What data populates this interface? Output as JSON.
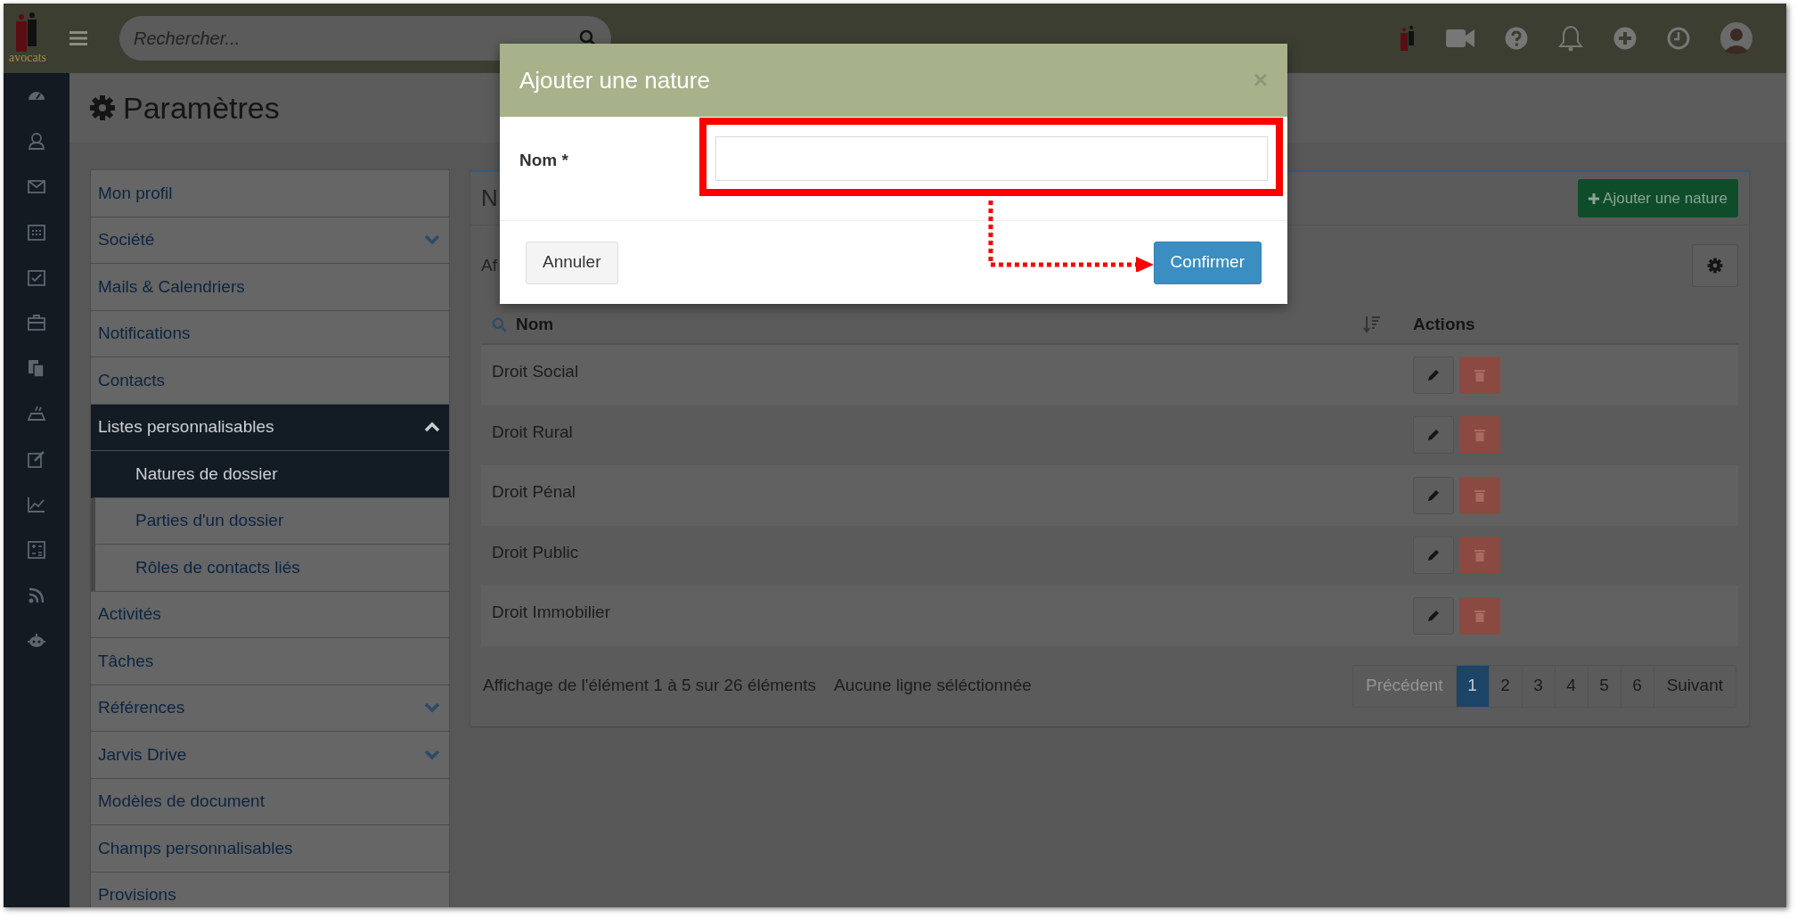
{
  "topbar": {
    "logo_text": "avocats",
    "search": {
      "placeholder": "Rechercher..."
    }
  },
  "page": {
    "title": "Paramètres"
  },
  "settings_menu": [
    {
      "label": "Mon profil",
      "kind": "link",
      "selected": false
    },
    {
      "label": "Société",
      "kind": "group",
      "expanded": false,
      "selected": false
    },
    {
      "label": "Mails & Calendriers",
      "kind": "link",
      "selected": false
    },
    {
      "label": "Notifications",
      "kind": "link",
      "selected": false
    },
    {
      "label": "Contacts",
      "kind": "link",
      "selected": false
    },
    {
      "label": "Listes personnalisables",
      "kind": "group",
      "expanded": true,
      "selected": true,
      "children": [
        {
          "label": "Natures de dossier",
          "selected": true
        },
        {
          "label": "Parties d'un dossier",
          "selected": false
        },
        {
          "label": "Rôles de contacts liés",
          "selected": false
        }
      ]
    },
    {
      "label": "Activités",
      "kind": "link",
      "selected": false
    },
    {
      "label": "Tâches",
      "kind": "link",
      "selected": false
    },
    {
      "label": "Références",
      "kind": "group",
      "expanded": false,
      "selected": false
    },
    {
      "label": "Jarvis Drive",
      "kind": "group",
      "expanded": false,
      "selected": false
    },
    {
      "label": "Modèles de document",
      "kind": "link",
      "selected": false
    },
    {
      "label": "Champs personnalisables",
      "kind": "link",
      "selected": false
    },
    {
      "label": "Provisions",
      "kind": "link",
      "selected": false
    }
  ],
  "panel": {
    "title": "N",
    "add_button": "Ajouter une nature",
    "info": "Af",
    "columns": [
      "Nom",
      "Actions"
    ],
    "rows": [
      "Droit Social",
      "Droit Rural",
      "Droit Pénal",
      "Droit Public",
      "Droit Immobilier"
    ],
    "summary": "Affichage de l'élément 1 à 5 sur 26 éléments",
    "selection_info": "Aucune ligne séléctionnée",
    "pagination": [
      {
        "label": "Précédent",
        "kind": "prev",
        "selected": false,
        "disabled": true
      },
      {
        "label": "1",
        "kind": "page",
        "selected": true,
        "disabled": false
      },
      {
        "label": "2",
        "kind": "page",
        "selected": false,
        "disabled": false
      },
      {
        "label": "3",
        "kind": "page",
        "selected": false,
        "disabled": false
      },
      {
        "label": "4",
        "kind": "page",
        "selected": false,
        "disabled": false
      },
      {
        "label": "5",
        "kind": "page",
        "selected": false,
        "disabled": false
      },
      {
        "label": "6",
        "kind": "page",
        "selected": false,
        "disabled": false
      },
      {
        "label": "Suivant",
        "kind": "next",
        "selected": false,
        "disabled": false
      }
    ]
  },
  "modal": {
    "title": "Ajouter une nature",
    "close": "×",
    "field": {
      "label": "Nom *"
    },
    "buttons": [
      {
        "label": "Annuler",
        "kind": "default"
      },
      {
        "label": "Confirmer",
        "kind": "primary"
      }
    ]
  }
}
